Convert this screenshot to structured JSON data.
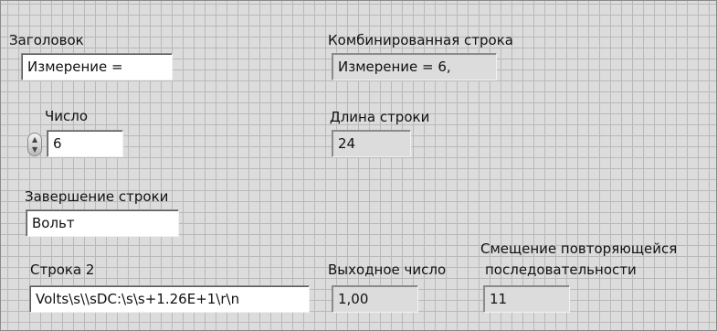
{
  "heading": {
    "label": "Заголовок",
    "value": "Измерение ="
  },
  "number": {
    "label": "Число",
    "value": "6"
  },
  "string_end": {
    "label": "Завершение строки",
    "value": "Вольт"
  },
  "string2": {
    "label": "Строка 2",
    "value": "Volts\\s\\\\sDC:\\s\\s+1.26E+1\\r\\n"
  },
  "combined": {
    "label": "Комбинированная строка",
    "value": "Измерение = 6,"
  },
  "length": {
    "label": "Длина строки",
    "value": "24"
  },
  "output_number": {
    "label": "Выходное число",
    "value": "1,00"
  },
  "offset": {
    "label_line1": "Смещение повторяющейся",
    "label_line2": "последовательности",
    "value": "11"
  },
  "colors": {
    "panel_bg": "#dcdcdc",
    "grid": "#b9b9b9",
    "control_bg": "#ffffff",
    "indicator_bg": "#dcdcdc"
  },
  "icons": {
    "spinner": "increment-decrement-icon"
  }
}
